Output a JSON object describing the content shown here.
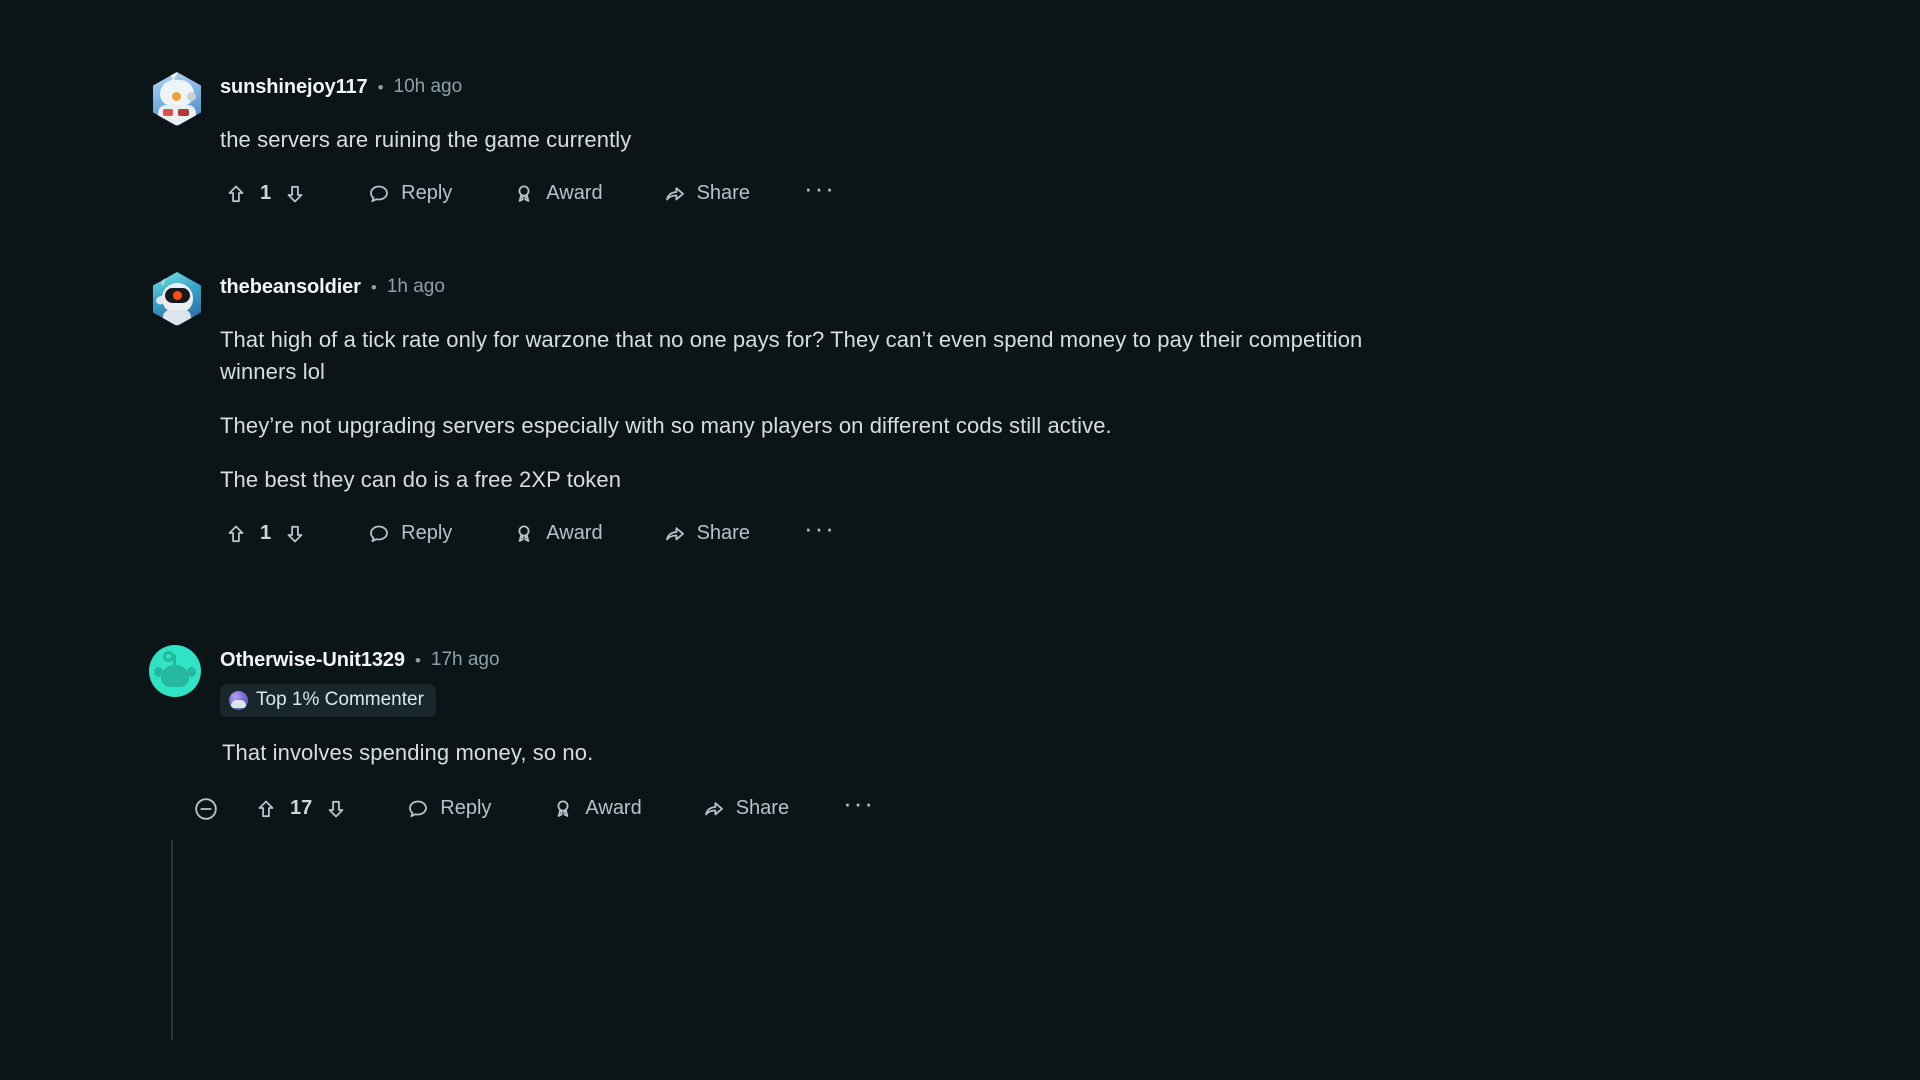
{
  "theme": {
    "background": "#0b1416",
    "text_primary": "#d7dde0",
    "text_muted": "#8ba0a8",
    "username": "#f2f4f5",
    "thread_line": "#2a3236",
    "badge_bg": "#17272b"
  },
  "separator": "•",
  "comments": [
    {
      "username": "sunshinejoy117",
      "timestamp": "10h ago",
      "avatar_icon": "gamer-snoo-avatar",
      "paragraphs": [
        "the servers are ruining the game currently"
      ],
      "vote_count": "1",
      "actions": {
        "upvote_icon": "upvote-arrow-icon",
        "downvote_icon": "downvote-arrow-icon",
        "reply_label": "Reply",
        "reply_icon": "comment-bubble-icon",
        "award_label": "Award",
        "award_icon": "award-medal-icon",
        "share_label": "Share",
        "share_icon": "share-arrow-icon",
        "overflow_label": "···"
      }
    },
    {
      "username": "thebeansoldier",
      "timestamp": "1h ago",
      "avatar_icon": "astronaut-snoo-avatar",
      "paragraphs": [
        "That high of a tick rate only for warzone that no one pays for? They can’t even spend money to pay their competition winners lol",
        "They’re not upgrading servers especially with so many players on different cods still active.",
        "The best they can do is a free 2XP token"
      ],
      "vote_count": "1",
      "actions": {
        "upvote_icon": "upvote-arrow-icon",
        "downvote_icon": "downvote-arrow-icon",
        "reply_label": "Reply",
        "reply_icon": "comment-bubble-icon",
        "award_label": "Award",
        "award_icon": "award-medal-icon",
        "share_label": "Share",
        "share_icon": "share-arrow-icon",
        "overflow_label": "···"
      }
    },
    {
      "username": "Otherwise-Unit1329",
      "timestamp": "17h ago",
      "avatar_icon": "teal-snoo-avatar",
      "badge": {
        "label": "Top 1% Commenter",
        "icon": "top-commenter-medal-icon"
      },
      "paragraphs": [
        "That involves spending money, so no."
      ],
      "vote_count": "17",
      "collapse_icon": "collapse-minus-icon",
      "actions": {
        "upvote_icon": "upvote-arrow-icon",
        "downvote_icon": "downvote-arrow-icon",
        "reply_label": "Reply",
        "reply_icon": "comment-bubble-icon",
        "award_label": "Award",
        "award_icon": "award-medal-icon",
        "share_label": "Share",
        "share_icon": "share-arrow-icon",
        "overflow_label": "···"
      }
    }
  ]
}
